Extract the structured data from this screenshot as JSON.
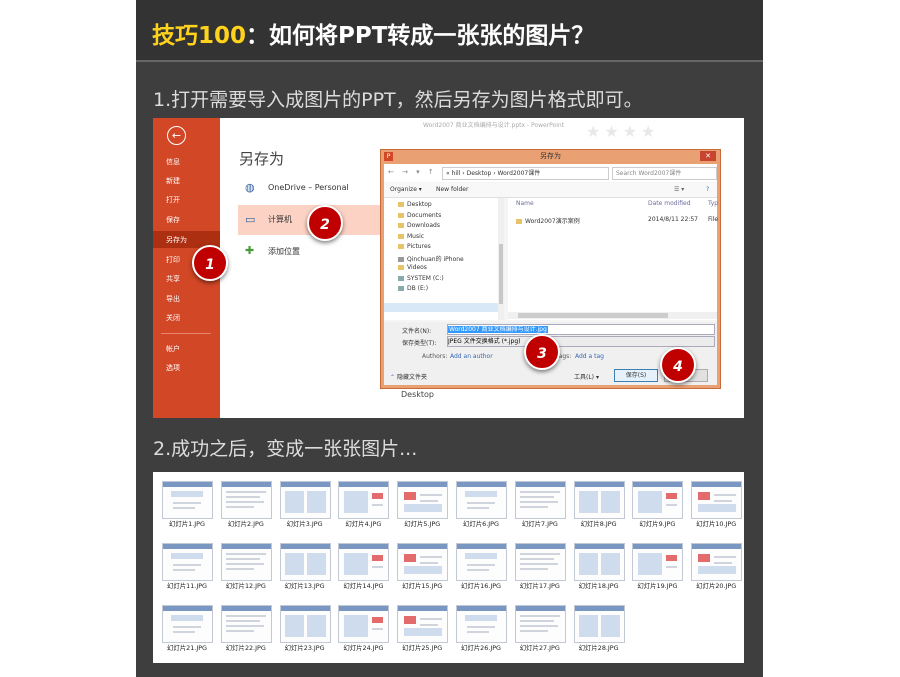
{
  "header": {
    "title_prefix": "技巧100",
    "title_main": "：如何将PPT转成一张张的图片？"
  },
  "steps": {
    "step1": "1.打开需要导入成图片的PPT，然后另存为图片格式即可。",
    "step2": "2.成功之后，变成一张张图片..."
  },
  "backstage": {
    "doc_name": "Word2007 商业文档编排与设计.pptx - PowerPoint",
    "menu": [
      "信息",
      "新建",
      "打开",
      "保存",
      "另存为",
      "打印",
      "共享",
      "导出",
      "关闭",
      "帐户",
      "选项"
    ],
    "active": "另存为",
    "heading": "另存为",
    "locations": [
      "OneDrive – Personal",
      "计算机",
      "添加位置"
    ],
    "recent_folder": "Desktop"
  },
  "dialog": {
    "title": "另存为",
    "address": "« hill  ›  Desktop  ›  Word2007课件",
    "search_placeholder": "Search Word2007课件",
    "organize": "Organize ▾",
    "new_folder": "New folder",
    "nav_items": [
      "Desktop",
      "Documents",
      "Downloads",
      "Music",
      "Pictures",
      "Qinchuan的 iPhone",
      "Videos",
      "SYSTEM (C:)",
      "DB (E:)"
    ],
    "columns": {
      "name": "Name",
      "date": "Date modified",
      "type": "Typ"
    },
    "files": [
      {
        "name": "Word2007演示案例",
        "date": "2014/8/11 22:57",
        "type": "File"
      }
    ],
    "filename_label": "文件名(N):",
    "filename_value": "Word2007 商业文档编排与设计.jpg",
    "savetype_label": "保存类型(T):",
    "savetype_value": "JPEG 文件交换格式 (*.jpg)",
    "authors_label": "Authors:",
    "authors_link": "Add an author",
    "tags_label": "Tags:",
    "tags_link": "Add a tag",
    "hide_folders": "隐藏文件夹",
    "tools": "工具(L)",
    "save": "保存(S)",
    "cancel": "取消"
  },
  "badges": [
    "1",
    "2",
    "3",
    "4"
  ],
  "thumbnails": [
    "幻灯片1.JPG",
    "幻灯片2.JPG",
    "幻灯片3.JPG",
    "幻灯片4.JPG",
    "幻灯片5.JPG",
    "幻灯片6.JPG",
    "幻灯片7.JPG",
    "幻灯片8.JPG",
    "幻灯片9.JPG",
    "幻灯片10.JPG",
    "幻灯片11.JPG",
    "幻灯片12.JPG",
    "幻灯片13.JPG",
    "幻灯片14.JPG",
    "幻灯片15.JPG",
    "幻灯片16.JPG",
    "幻灯片17.JPG",
    "幻灯片18.JPG",
    "幻灯片19.JPG",
    "幻灯片20.JPG",
    "幻灯片21.JPG",
    "幻灯片22.JPG",
    "幻灯片23.JPG",
    "幻灯片24.JPG",
    "幻灯片25.JPG",
    "幻灯片26.JPG",
    "幻灯片27.JPG",
    "幻灯片28.JPG"
  ],
  "colors": {
    "accent": "#ffd21c",
    "ppt_orange": "#d24726",
    "badge_red": "#c00000",
    "panel": "#3e3e3e"
  }
}
